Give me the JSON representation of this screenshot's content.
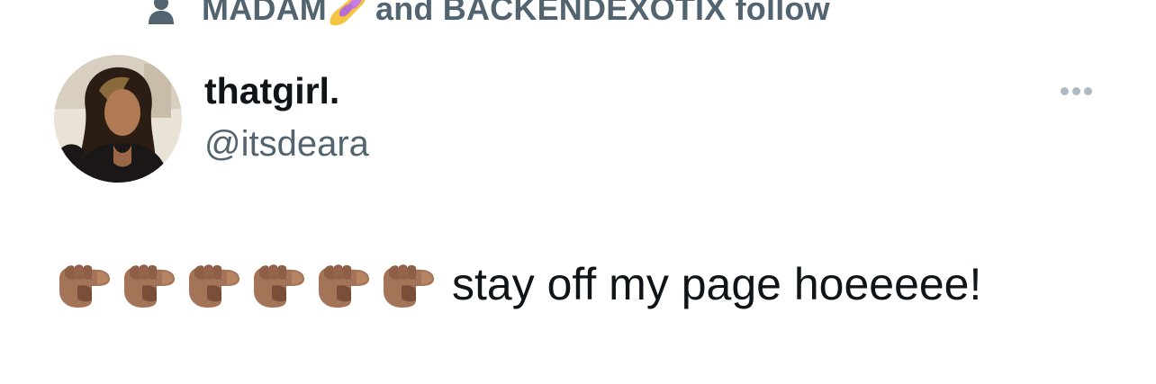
{
  "social_context": {
    "icon": "person-icon",
    "name_left": "MADAM",
    "emoji": "nail-polish",
    "rest": " and BACKENDEXOTIX follow"
  },
  "author": {
    "display_name": "thatgirl.",
    "handle": "@itsdeara",
    "avatar": "profile-photo"
  },
  "actions": {
    "more_icon": "more-horizontal-icon"
  },
  "tweet": {
    "emoji": "backhand-index-pointing-right-medium-dark-skin-tone",
    "emoji_count": 6,
    "text": "stay off my page hoeeeee!"
  },
  "colors": {
    "primary_text": "#0f1419",
    "secondary_text": "#536471",
    "dots": "#aeb9c2",
    "skin_tone": "#a47459"
  }
}
